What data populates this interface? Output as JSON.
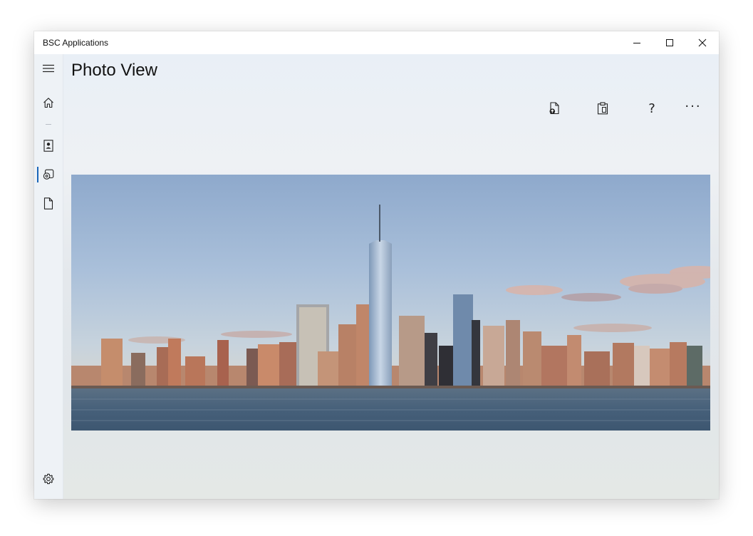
{
  "window": {
    "title": "BSC Applications",
    "controls": [
      "minimize-icon",
      "maximize-icon",
      "close-icon"
    ]
  },
  "sidebar": {
    "items": [
      {
        "name": "hamburger-menu",
        "icon": "hamburger-icon"
      },
      {
        "name": "home",
        "icon": "home-icon"
      },
      {
        "name": "contact",
        "icon": "contact-card-icon"
      },
      {
        "name": "photo-view",
        "icon": "photo-icon",
        "active": true
      },
      {
        "name": "document",
        "icon": "document-icon"
      },
      {
        "name": "settings",
        "icon": "gear-icon"
      }
    ],
    "accent_color": "#1b66b9"
  },
  "page": {
    "title": "Photo View"
  },
  "commandbar": {
    "buttons": [
      {
        "name": "open-photo-button",
        "icon": "open-file-icon"
      },
      {
        "name": "paste-button",
        "icon": "clipboard-icon"
      },
      {
        "name": "help-button",
        "icon": "help-icon",
        "glyph": "?"
      },
      {
        "name": "more-button",
        "icon": "more-icon",
        "glyph": "···"
      }
    ]
  },
  "photo": {
    "subject": "city-skyline-photo"
  }
}
